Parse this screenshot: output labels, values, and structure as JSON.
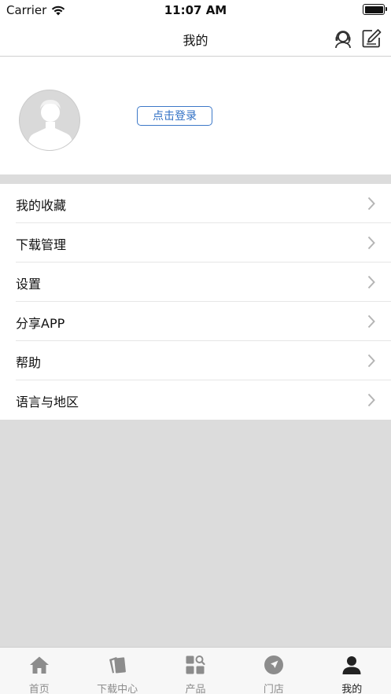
{
  "status_bar": {
    "carrier": "Carrier",
    "time": "11:07 AM"
  },
  "nav": {
    "title": "我的",
    "left_icon": "customer-service-icon",
    "right_icon": "edit-icon"
  },
  "profile": {
    "login_label": "点击登录"
  },
  "menu": {
    "items": [
      {
        "label": "我的收藏"
      },
      {
        "label": "下载管理"
      },
      {
        "label": "设置"
      },
      {
        "label": "分享APP"
      },
      {
        "label": "帮助"
      },
      {
        "label": "语言与地区"
      }
    ]
  },
  "tab_bar": {
    "tabs": [
      {
        "label": "首页",
        "icon": "home-icon"
      },
      {
        "label": "下载中心",
        "icon": "documents-icon"
      },
      {
        "label": "产品",
        "icon": "products-grid-icon"
      },
      {
        "label": "门店",
        "icon": "location-icon"
      },
      {
        "label": "我的",
        "icon": "person-icon"
      }
    ],
    "active_index": 4
  },
  "colors": {
    "accent": "#2f6fc4",
    "background": "#dcdcdc",
    "inactive_tab": "#8c8c8c",
    "active_tab": "#222222"
  }
}
